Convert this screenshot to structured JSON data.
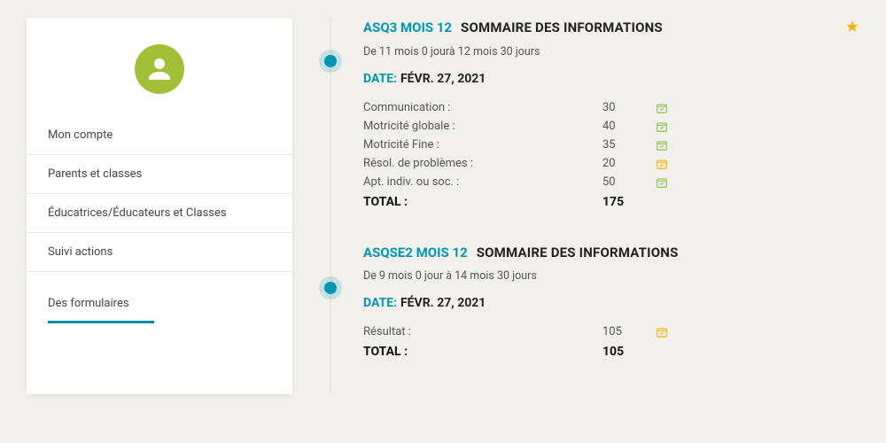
{
  "sidebar": {
    "items": [
      {
        "label": "Mon compte"
      },
      {
        "label": "Parents et classes"
      },
      {
        "label": "Éducatrices/Éducateurs et Classes"
      },
      {
        "label": "Suivi actions"
      },
      {
        "label": "Des formulaires"
      }
    ]
  },
  "entries": [
    {
      "title_main": "ASQ3 MOIS 12",
      "title_sub": "SOMMAIRE DES INFORMATIONS",
      "starred": true,
      "range": "De 11 mois 0 jourà 12 mois 30 jours",
      "date_label": "DATE:",
      "date_value": "FÉVR. 27, 2021",
      "scores": [
        {
          "label": "Communication :",
          "value": "30",
          "status": "green"
        },
        {
          "label": "Motricité globale :",
          "value": "40",
          "status": "green"
        },
        {
          "label": "Motricité Fine :",
          "value": "35",
          "status": "green"
        },
        {
          "label": "Résol. de problèmes :",
          "value": "20",
          "status": "amber"
        },
        {
          "label": "Apt. indiv. ou soc. :",
          "value": "50",
          "status": "green"
        }
      ],
      "total_label": "TOTAL :",
      "total_value": "175"
    },
    {
      "title_main": "ASQSE2 MOIS 12",
      "title_sub": "SOMMAIRE DES INFORMATIONS",
      "starred": false,
      "range": "De 9 mois 0 jour à 14 mois 30 jours",
      "date_label": "DATE:",
      "date_value": "FÉVR. 27, 2021",
      "scores": [
        {
          "label": "Résultat :",
          "value": "105",
          "status": "amber"
        }
      ],
      "total_label": "TOTAL :",
      "total_value": "105"
    }
  ],
  "colors": {
    "accent": "#0097b2",
    "avatar": "#a2c037",
    "star": "#f5b400",
    "green": "#8bc34a",
    "amber": "#f5b400"
  }
}
